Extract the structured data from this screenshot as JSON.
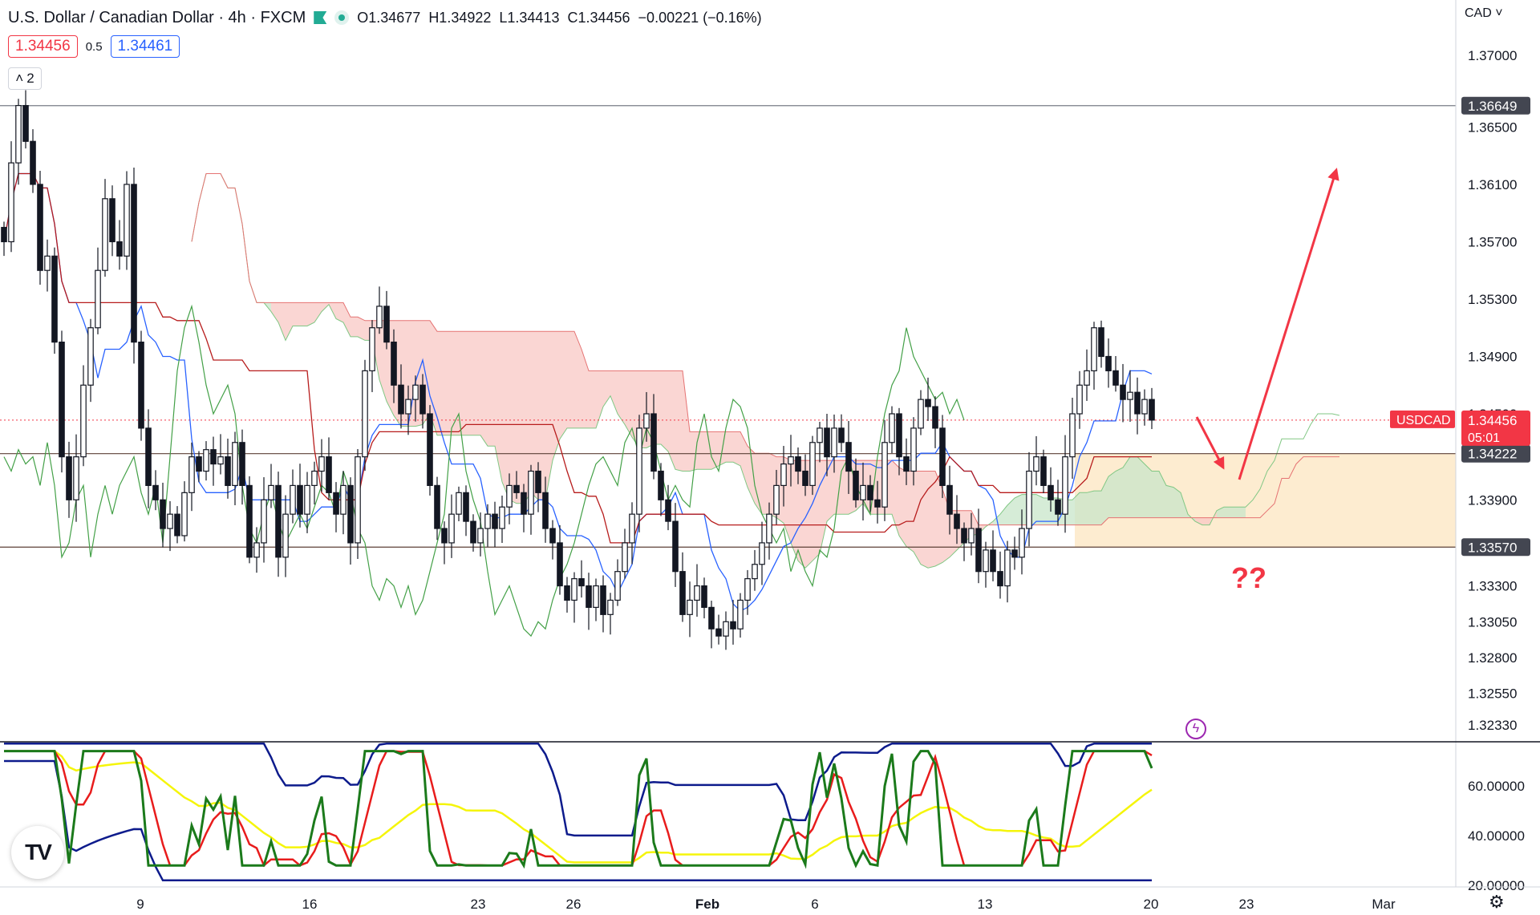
{
  "header": {
    "symbol_title": "U.S. Dollar / Canadian Dollar · 4h · FXCM",
    "open": "O1.34677",
    "high": "H1.34922",
    "low": "L1.34413",
    "close": "C1.34456",
    "change": "−0.00221 (−0.16%)",
    "sell_price": "1.34456",
    "spread": "0.5",
    "buy_price": "1.34461",
    "collapse_count": "2",
    "currency": "CAD"
  },
  "colors": {
    "up": "#26a69a",
    "down": "#ef5350",
    "candle": "#131722",
    "tenkan": "#2962ff",
    "kijun": "#b71c1c",
    "chikou": "#43a047",
    "cloud_bear": "#f8c8c4",
    "cloud_bull": "#c8e6c9",
    "zone": "#fde9c8",
    "arrow": "#f23645",
    "rsi_green": "#1b7a1b",
    "rsi_red": "#e81c1c",
    "rsi_yellow": "#f5f50a",
    "band_navy": "#0d1b8c"
  },
  "annotation": "??",
  "chart_data": {
    "type": "candlestick",
    "title": "U.S. Dollar / Canadian Dollar · 4h · FXCM",
    "price_axis": {
      "ticks": [
        "1.37000",
        "1.36500",
        "1.36100",
        "1.35700",
        "1.35300",
        "1.34900",
        "1.34500",
        "1.33900",
        "1.33300",
        "1.33050",
        "1.32800",
        "1.32550",
        "1.32330"
      ],
      "ylim": [
        1.3215,
        1.3725
      ]
    },
    "x_ticks": [
      "9",
      "16",
      "23",
      "26",
      "Feb",
      "6",
      "13",
      "20",
      "23",
      "Mar"
    ],
    "horizontal_lines": [
      {
        "price": 1.36649,
        "label": "1.36649"
      },
      {
        "price": 1.34222,
        "label": "1.34222"
      },
      {
        "price": 1.3357,
        "label": "1.33570"
      }
    ],
    "last_price": {
      "label": "USDCAD",
      "value": "1.34456",
      "timer": "05:01",
      "price": 1.34456
    },
    "closes": [
      1.357,
      1.3625,
      1.3665,
      1.364,
      1.361,
      1.355,
      1.356,
      1.35,
      1.342,
      1.339,
      1.342,
      1.347,
      1.351,
      1.355,
      1.36,
      1.357,
      1.356,
      1.361,
      1.35,
      1.344,
      1.34,
      1.339,
      1.337,
      1.338,
      1.3365,
      1.3395,
      1.342,
      1.341,
      1.3425,
      1.3415,
      1.342,
      1.34,
      1.343,
      1.34,
      1.335,
      1.336,
      1.339,
      1.34,
      1.335,
      1.338,
      1.34,
      1.338,
      1.34,
      1.341,
      1.342,
      1.3395,
      1.338,
      1.34,
      1.336,
      1.342,
      1.348,
      1.351,
      1.3525,
      1.35,
      1.347,
      1.345,
      1.346,
      1.347,
      1.345,
      1.34,
      1.337,
      1.336,
      1.338,
      1.3395,
      1.3375,
      1.336,
      1.337,
      1.338,
      1.337,
      1.3385,
      1.34,
      1.3395,
      1.338,
      1.341,
      1.3395,
      1.337,
      1.336,
      1.333,
      1.332,
      1.3335,
      1.333,
      1.3315,
      1.333,
      1.331,
      1.332,
      1.334,
      1.336,
      1.338,
      1.344,
      1.345,
      1.341,
      1.339,
      1.3375,
      1.334,
      1.331,
      1.332,
      1.333,
      1.3315,
      1.33,
      1.3295,
      1.3305,
      1.33,
      1.332,
      1.3335,
      1.3345,
      1.336,
      1.338,
      1.34,
      1.3415,
      1.342,
      1.341,
      1.34,
      1.343,
      1.344,
      1.342,
      1.344,
      1.343,
      1.341,
      1.339,
      1.34,
      1.339,
      1.3385,
      1.343,
      1.345,
      1.342,
      1.341,
      1.344,
      1.346,
      1.3455,
      1.344,
      1.34,
      1.338,
      1.337,
      1.336,
      1.337,
      1.334,
      1.3355,
      1.334,
      1.333,
      1.3355,
      1.335,
      1.337,
      1.341,
      1.342,
      1.34,
      1.339,
      1.338,
      1.342,
      1.345,
      1.347,
      1.348,
      1.351,
      1.349,
      1.348,
      1.347,
      1.346,
      1.3465,
      1.345,
      1.346,
      1.34456
    ]
  },
  "oscillator": {
    "ticks": [
      "60.00000",
      "40.00000",
      "20.00000"
    ],
    "ylim": [
      18,
      78
    ],
    "series": [
      {
        "key": "band_top"
      },
      {
        "key": "band_bottom"
      },
      {
        "key": "signal"
      },
      {
        "key": "rsi_fast"
      },
      {
        "key": "rsi_slow"
      }
    ]
  }
}
